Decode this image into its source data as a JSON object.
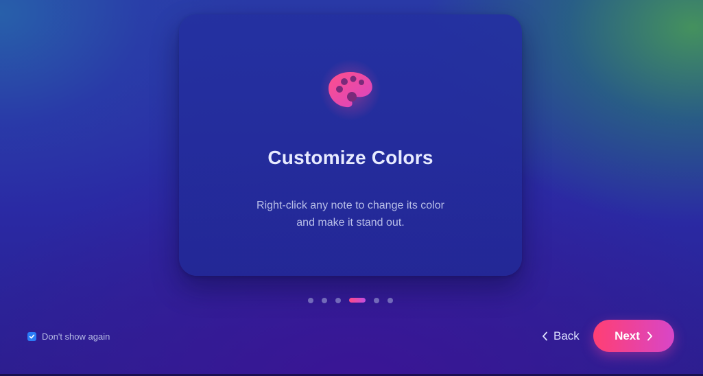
{
  "card": {
    "icon": "palette-icon",
    "title": "Customize Colors",
    "description_line1": "Right-click any note to change its color",
    "description_line2": "and make it stand out."
  },
  "pager": {
    "total_pages": 6,
    "current_page": 4
  },
  "footer": {
    "dont_show_label": "Don't show again",
    "dont_show_checked": true,
    "back_label": "Back",
    "next_label": "Next"
  },
  "colors": {
    "accent_start": "#ff3f73",
    "accent_end": "#d846c8",
    "checkbox": "#2a7cf6"
  }
}
